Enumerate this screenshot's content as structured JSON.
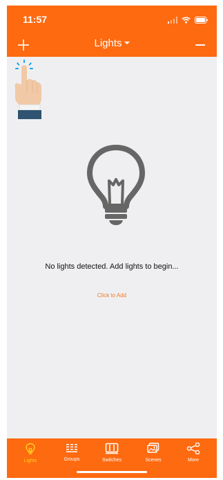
{
  "status_bar": {
    "time": "11:57",
    "icons": [
      "signal-icon",
      "wifi-icon",
      "battery-icon"
    ]
  },
  "navbar": {
    "title": "Lights",
    "left_icon": "plus-icon",
    "right_icon": "minus-icon"
  },
  "empty_state": {
    "icon": "lightbulb-icon",
    "message": "No lights detected. Add lights to begin...",
    "action_label": "Click to Add"
  },
  "tab_bar": {
    "items": [
      {
        "label": "Lights",
        "icon": "lightbulb-icon",
        "active": true
      },
      {
        "label": "Groups",
        "icon": "groups-icon",
        "active": false
      },
      {
        "label": "Switches",
        "icon": "switches-icon",
        "active": false
      },
      {
        "label": "Scenes",
        "icon": "scenes-icon",
        "active": false
      },
      {
        "label": "More",
        "icon": "share-icon",
        "active": false
      }
    ]
  },
  "colors": {
    "accent": "#fe6a10",
    "active_tab": "#ffd31e",
    "link": "#f47a20",
    "background": "#efeff1",
    "bulb": "#666666"
  }
}
